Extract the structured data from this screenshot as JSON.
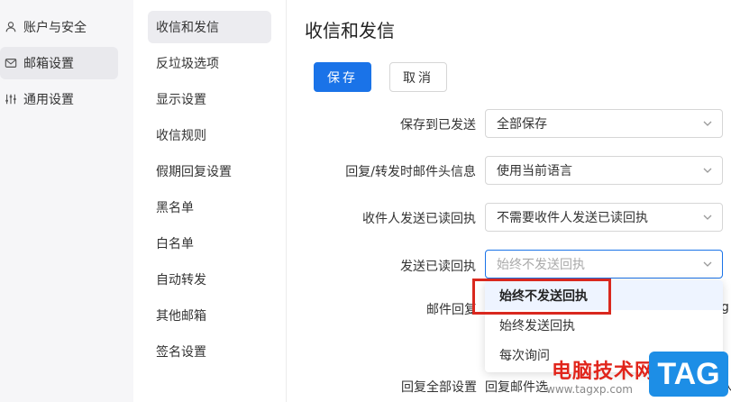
{
  "left_nav": {
    "items": [
      {
        "label": "账户与安全",
        "icon": "user-icon"
      },
      {
        "label": "邮箱设置",
        "icon": "mailbox-icon",
        "active": true
      },
      {
        "label": "通用设置",
        "icon": "sliders-icon"
      }
    ]
  },
  "sub_nav": {
    "items": [
      {
        "label": "收信和发信",
        "active": true
      },
      {
        "label": "反垃圾选项"
      },
      {
        "label": "显示设置"
      },
      {
        "label": "收信规则"
      },
      {
        "label": "假期回复设置"
      },
      {
        "label": "黑名单"
      },
      {
        "label": "白名单"
      },
      {
        "label": "自动转发"
      },
      {
        "label": "其他邮箱"
      },
      {
        "label": "签名设置"
      }
    ]
  },
  "main": {
    "title": "收信和发信",
    "save_label": "保存",
    "cancel_label": "取消",
    "settings": [
      {
        "label": "保存到已发送",
        "value": "全部保存"
      },
      {
        "label": "回复/转发时邮件头信息",
        "value": "使用当前语言"
      },
      {
        "label": "收件人发送已读回执",
        "value": "不需要收件人发送已读回执"
      },
      {
        "label": "发送已读回执",
        "value": "始终不发送回执"
      }
    ],
    "partial_labels": {
      "reply_format": "邮件回复",
      "reply_all": "回复全部设置",
      "reply_all_value": "回复邮件选",
      "right_edge_1": "g",
      "right_edge_2": "人"
    },
    "dropdown_options": [
      {
        "label": "始终不发送回执",
        "selected": true
      },
      {
        "label": "始终发送回执"
      },
      {
        "label": "每次询问"
      }
    ]
  },
  "watermark": {
    "text": "电脑技术网",
    "url": "www.tagxp.com",
    "tag": "TAG"
  },
  "colors": {
    "primary": "#1a73e8",
    "highlight": "#d9281e",
    "watermark_red": "#e1251b",
    "watermark_blue": "#1d8ee6"
  }
}
